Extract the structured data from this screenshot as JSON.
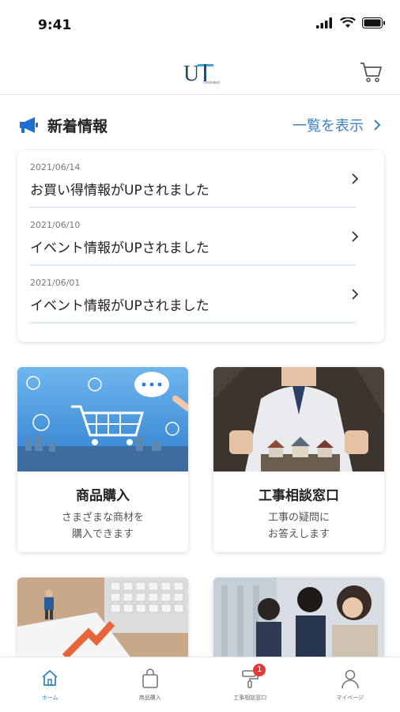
{
  "status_bar": {
    "time": "9:41"
  },
  "header": {
    "logo_text": "UT",
    "logo_sub": "Unlimited",
    "cart_icon": "cart-icon"
  },
  "news": {
    "title": "新着情報",
    "more_label": "一覧を表示",
    "items": [
      {
        "date": "2021/06/14",
        "text": "お買い得情報がUPされました"
      },
      {
        "date": "2021/06/10",
        "text": "イベント情報がUPされました"
      },
      {
        "date": "2021/06/01",
        "text": "イベント情報がUPされました"
      }
    ]
  },
  "tiles": [
    {
      "title": "商品購入",
      "desc_line1": "さまざまな商材を",
      "desc_line2": "購入できます"
    },
    {
      "title": "工事相談窓口",
      "desc_line1": "工事の疑問に",
      "desc_line2": "お答えします"
    }
  ],
  "tab_bar": {
    "items": [
      {
        "label": "ホーム",
        "icon": "home-icon"
      },
      {
        "label": "商品購入",
        "icon": "bag-icon"
      },
      {
        "label": "工事相談窓口",
        "icon": "paint-roller-icon",
        "badge": "1"
      },
      {
        "label": "マイページ",
        "icon": "user-icon"
      }
    ]
  },
  "colors": {
    "accent": "#3b82c4",
    "badge": "#e53935",
    "divider": "#dde9f7"
  }
}
